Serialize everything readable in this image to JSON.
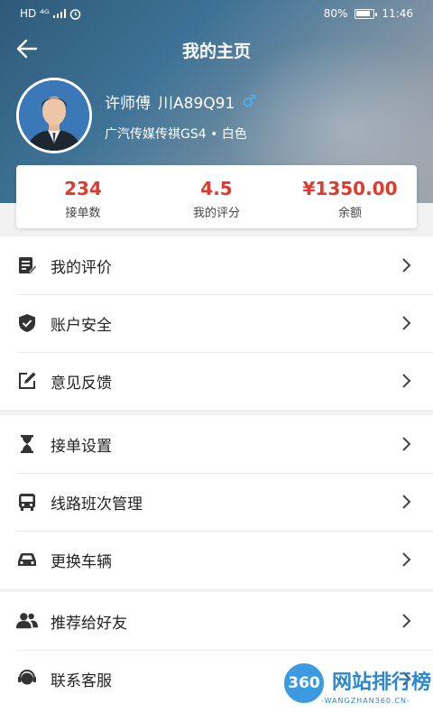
{
  "status": {
    "net": "HD ⁴ᴳ",
    "battery": "80%",
    "time": "11:46"
  },
  "header": {
    "title": "我的主页"
  },
  "profile": {
    "name": "许师傅",
    "plate": "川A89Q91",
    "gender": "♂",
    "car": "广汽传媒传祺GS4 • 白色"
  },
  "stats": [
    {
      "value": "234",
      "label": "接单数"
    },
    {
      "value": "4.5",
      "label": "我的评分"
    },
    {
      "value": "¥1350.00",
      "label": "余额"
    }
  ],
  "menu": {
    "group1": [
      "我的评价",
      "账户安全",
      "意见反馈"
    ],
    "group2": [
      "接单设置",
      "线路班次管理",
      "更换车辆"
    ],
    "group3": [
      "推荐给好友",
      "联系客服"
    ]
  },
  "watermark": {
    "logo": "360",
    "text": "网站排行榜",
    "url": "-WANGZHAN360.CN-"
  },
  "colors": {
    "accent": "#e03a2c",
    "gender": "#3fb0ff"
  }
}
